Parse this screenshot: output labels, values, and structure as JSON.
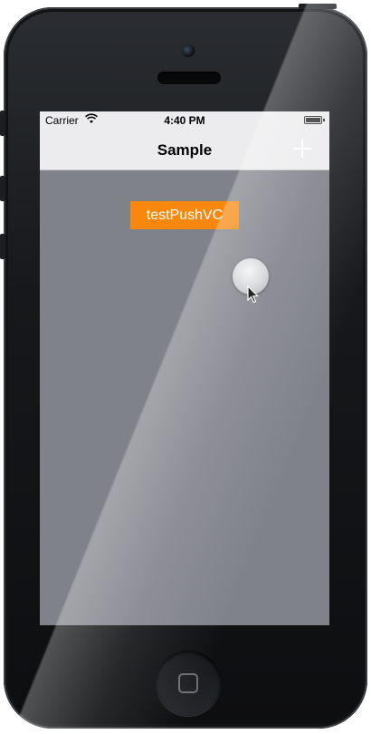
{
  "status_bar": {
    "carrier": "Carrier",
    "time": "4:40 PM",
    "wifi_icon": "wifi-icon",
    "battery_icon": "battery-icon"
  },
  "nav_bar": {
    "title": "Sample",
    "add_icon": "plus-icon"
  },
  "content": {
    "push_button_label": "testPushVC",
    "push_button_color": "#f7880d",
    "background_color": "#80828a"
  },
  "device": {
    "home_button_icon": "home-square-icon",
    "assistive_touch_icon": "assistive-touch-icon"
  }
}
